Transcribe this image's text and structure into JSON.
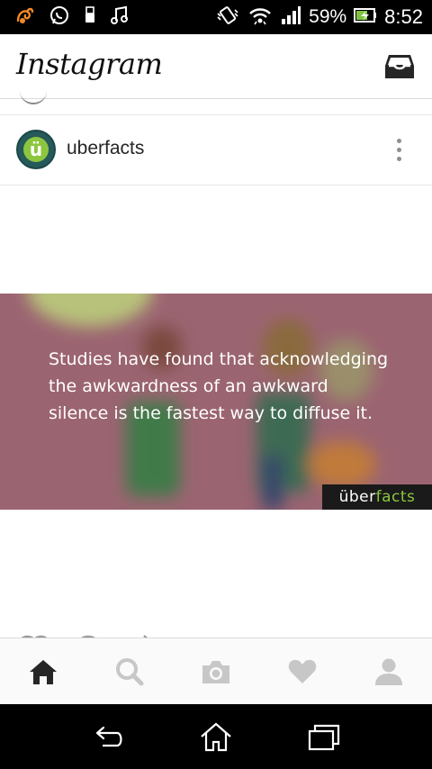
{
  "status_bar": {
    "battery": "59%",
    "time": "8:52",
    "left_icons": [
      "uc-browser-icon",
      "whatsapp-icon",
      "usb-icon",
      "music-note-icon"
    ],
    "right_icons": [
      "vibrate-icon",
      "wifi-icon",
      "signal-icon",
      "battery-charging-icon"
    ]
  },
  "app_header": {
    "title": "Instagram",
    "inbox_icon": "inbox-icon"
  },
  "post": {
    "username": "uberfacts",
    "avatar_letter": "ü",
    "caption": "Studies have found that acknowledging the awkwardness of an awkward silence is the fastest way to diffuse it.",
    "brand_prefix": "über",
    "brand_suffix": "facts"
  },
  "tab_bar": {
    "tabs": [
      {
        "name": "home",
        "icon": "home-icon",
        "active": true
      },
      {
        "name": "search",
        "icon": "search-icon",
        "active": false
      },
      {
        "name": "camera",
        "icon": "camera-icon",
        "active": false
      },
      {
        "name": "activity",
        "icon": "heart-icon",
        "active": false
      },
      {
        "name": "profile",
        "icon": "person-icon",
        "active": false
      }
    ]
  },
  "nav_bar": {
    "buttons": [
      "back-icon",
      "home-icon",
      "recents-icon"
    ]
  },
  "colors": {
    "post_background": "#9b6471",
    "brand_accent": "#8cc63f",
    "avatar_ring": "#26595a",
    "active_tab": "#262626",
    "inactive_tab": "#c7c7c7"
  }
}
